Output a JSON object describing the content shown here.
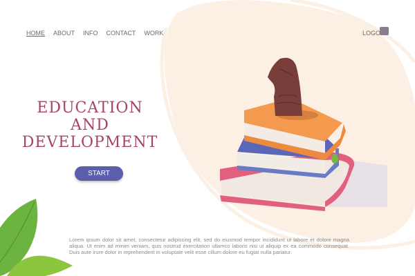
{
  "nav": {
    "items": [
      "HOME",
      "ABOUT",
      "INFO",
      "CONTACT",
      "WORK"
    ],
    "active": "HOME"
  },
  "logo": {
    "label": "LOGO"
  },
  "hero": {
    "title_lines": [
      "EDUCATION",
      "AND",
      "DEVELOPMENT"
    ],
    "start_label": "START",
    "body": "Lorem ipsum dolor sit amet, consectetur adipiscing elit, sed do eiusmod tempor incididunt ut labore et dolore magna aliqua. Ut enim ad minim veniam, quis nostrud exercitation ullamco laboris nisi ut aliquip ex ea commodo consequat. Duis aute irure dolor in reprehenderit in voluptate velit esse cillum dolore eu fugiat nulla pariatur."
  },
  "colors": {
    "title": "#a8455e",
    "button": "#5a5eac",
    "blob": "#fcefe3"
  }
}
